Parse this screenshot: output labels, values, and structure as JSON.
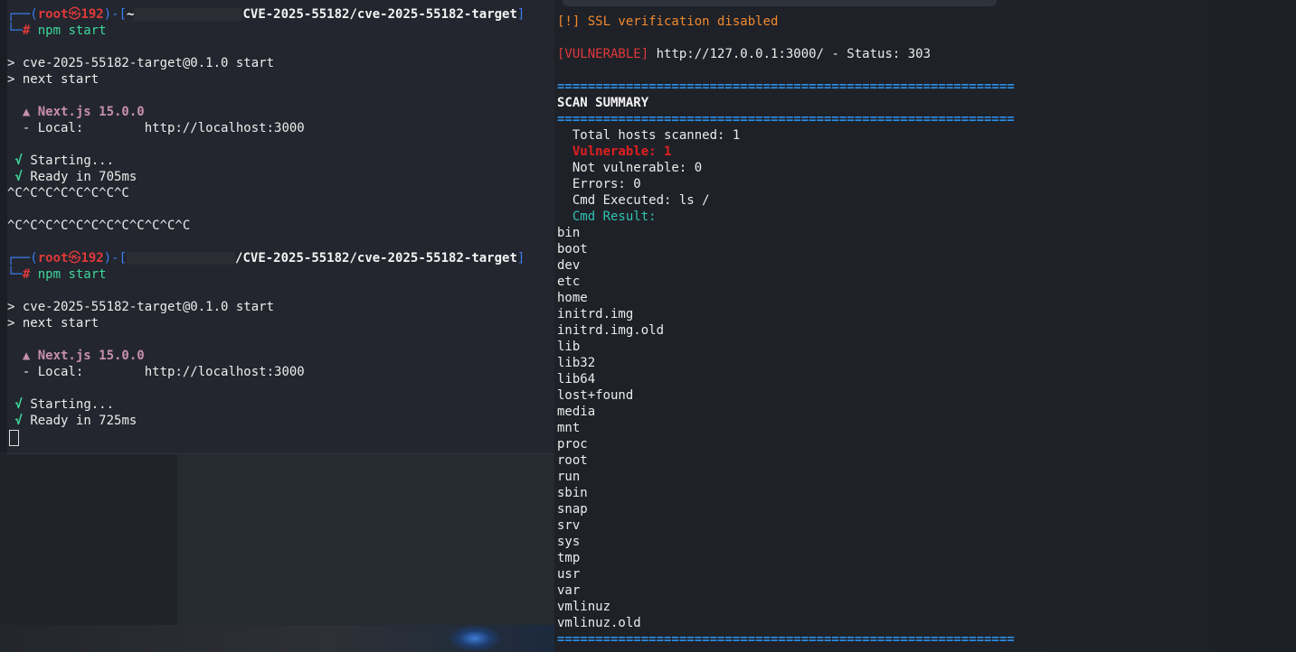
{
  "left_terminal": {
    "session1": {
      "prompt_user": "root",
      "prompt_skull": "㉿",
      "prompt_host": "192",
      "prompt_path_prefix": "~",
      "prompt_path": "CVE-2025-55182/cve-2025-55182-target",
      "command": "npm start",
      "line_start": "> cve-2025-55182-target@0.1.0 start",
      "line_next": "> next start",
      "next_label": "▲ Next.js 15.0.0",
      "local_label": "- Local:",
      "local_url": "http://localhost:3000",
      "starting": "Starting...",
      "ready": "Ready in 705ms",
      "check": "√",
      "ctrl1": "^C^C^C^C^C^C^C^C",
      "ctrl2": "^C^C^C^C^C^C^C^C^C^C^C^C"
    },
    "session2": {
      "prompt_user": "root",
      "prompt_skull": "㉿",
      "prompt_host": "192",
      "prompt_path": "/CVE-2025-55182/cve-2025-55182-target",
      "command": "npm start",
      "line_start": "> cve-2025-55182-target@0.1.0 start",
      "line_next": "> next start",
      "next_label": "▲ Next.js 15.0.0",
      "local_label": "- Local:",
      "local_url": "http://localhost:3000",
      "starting": "Starting...",
      "ready": "Ready in 725ms",
      "check": "√"
    }
  },
  "right_terminal": {
    "ssl_warning": "[!] SSL verification disabled",
    "vuln_tag": "[VULNERABLE]",
    "vuln_text": " http://127.0.0.1:3000/ - Status: 303",
    "separator": "============================================================",
    "summary_title": "SCAN SUMMARY",
    "total_hosts": "Total hosts scanned: 1",
    "vulnerable": "Vulnerable: 1",
    "not_vulnerable": "Not vulnerable: 0",
    "errors": "Errors: 0",
    "cmd_executed": "Cmd Executed: ls /",
    "cmd_result": "Cmd Result:",
    "dirs": [
      "bin",
      "boot",
      "dev",
      "etc",
      "home",
      "initrd.img",
      "initrd.img.old",
      "lib",
      "lib32",
      "lib64",
      "lost+found",
      "media",
      "mnt",
      "proc",
      "root",
      "run",
      "sbin",
      "snap",
      "srv",
      "sys",
      "tmp",
      "usr",
      "var",
      "vmlinuz",
      "vmlinuz.old"
    ]
  },
  "colors": {
    "prompt_blue": "#3b7ff2",
    "prompt_red": "#e0393b",
    "success_green": "#3fd69b",
    "warning_orange": "#f08a2e",
    "vulnerable_red": "#e01f1f",
    "separator_blue": "#2c8fe6"
  }
}
